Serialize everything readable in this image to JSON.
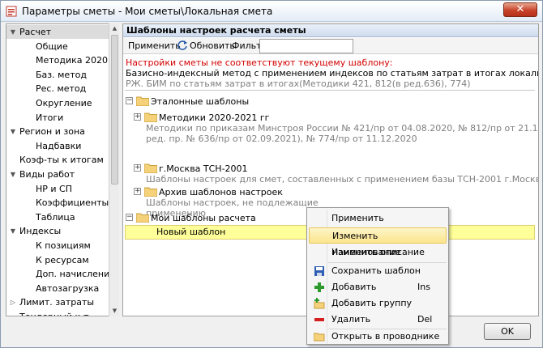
{
  "window": {
    "title": "Параметры сметы - Мои сметы\\Локальная смета",
    "close_label": "✕"
  },
  "nav": {
    "items": [
      {
        "label": "Расчет",
        "level": 0,
        "arrow": "down"
      },
      {
        "label": "Общие",
        "level": 1
      },
      {
        "label": "Методика 2020",
        "level": 1
      },
      {
        "label": "Баз. метод",
        "level": 1
      },
      {
        "label": "Рес. метод",
        "level": 1
      },
      {
        "label": "Округление",
        "level": 1
      },
      {
        "label": "Итоги",
        "level": 1
      },
      {
        "label": "Регион и зона",
        "level": 0,
        "arrow": "down"
      },
      {
        "label": "Надбавки",
        "level": 1
      },
      {
        "label": "Коэф-ты к итогам",
        "level": 0
      },
      {
        "label": "Виды работ",
        "level": 0,
        "arrow": "down"
      },
      {
        "label": "НР и СП",
        "level": 1
      },
      {
        "label": "Коэффициенты",
        "level": 1
      },
      {
        "label": "Таблица",
        "level": 1
      },
      {
        "label": "Индексы",
        "level": 0,
        "arrow": "down"
      },
      {
        "label": "К позициям",
        "level": 1
      },
      {
        "label": "К ресурсам",
        "level": 1
      },
      {
        "label": "Доп. начисления",
        "level": 1
      },
      {
        "label": "Автозагрузка",
        "level": 1
      },
      {
        "label": "Лимит. затраты",
        "level": 0,
        "arrow": "right"
      },
      {
        "label": "Тендерный к-т",
        "level": 0
      }
    ],
    "selected_index": 0
  },
  "panel": {
    "title": "Шаблоны настроек расчета сметы",
    "apply_label": "Применить",
    "refresh_label": "Обновить",
    "filter_label": "Фильтр",
    "filter_value": "",
    "warning": "Настройки сметы не соответствуют текущему шаблону:",
    "desc_line1": "Базисно-индексный метод с применением индексов по статьям затрат в итогах локальной сметы",
    "desc_line2": "РЖ. БИМ по статьям затрат в итогах(Методики 421, 812(в ред.636), 774)"
  },
  "tree": {
    "reference_group": "Эталонные шаблоны",
    "items": [
      {
        "title": "Методики 2020-2021 гг",
        "sub1": "Методики по приказам Минстроя России № 421/пр от 04.08.2020, № 812/пр от 21.12.2020 (в",
        "sub2": "ред. пр. № 636/пр от 02.09.2021), № 774/пр от 11.12.2020"
      },
      {
        "title": "г.Москва ТСН-2001",
        "sub1": "Шаблоны настроек для смет, составленных с применением базы ТСН-2001 г.Москвы",
        "sub2": ""
      },
      {
        "title": "Архив шаблонов настроек",
        "sub1": "Шаблоны настроек, не подлежащие",
        "sub2": "применению"
      }
    ],
    "my_group": "Мои шаблоны расчета",
    "new_template": "Новый шаблон"
  },
  "context_menu": {
    "apply": "Применить",
    "rename": "Изменить наименование",
    "edit_desc": "Изменить описание",
    "save": "Сохранить шаблон",
    "add": "Добавить",
    "add_shortcut": "Ins",
    "add_group": "Добавить группу",
    "delete": "Удалить",
    "delete_shortcut": "Del",
    "open_explorer": "Открыть в проводнике"
  },
  "footer": {
    "ok_label": "OK"
  }
}
